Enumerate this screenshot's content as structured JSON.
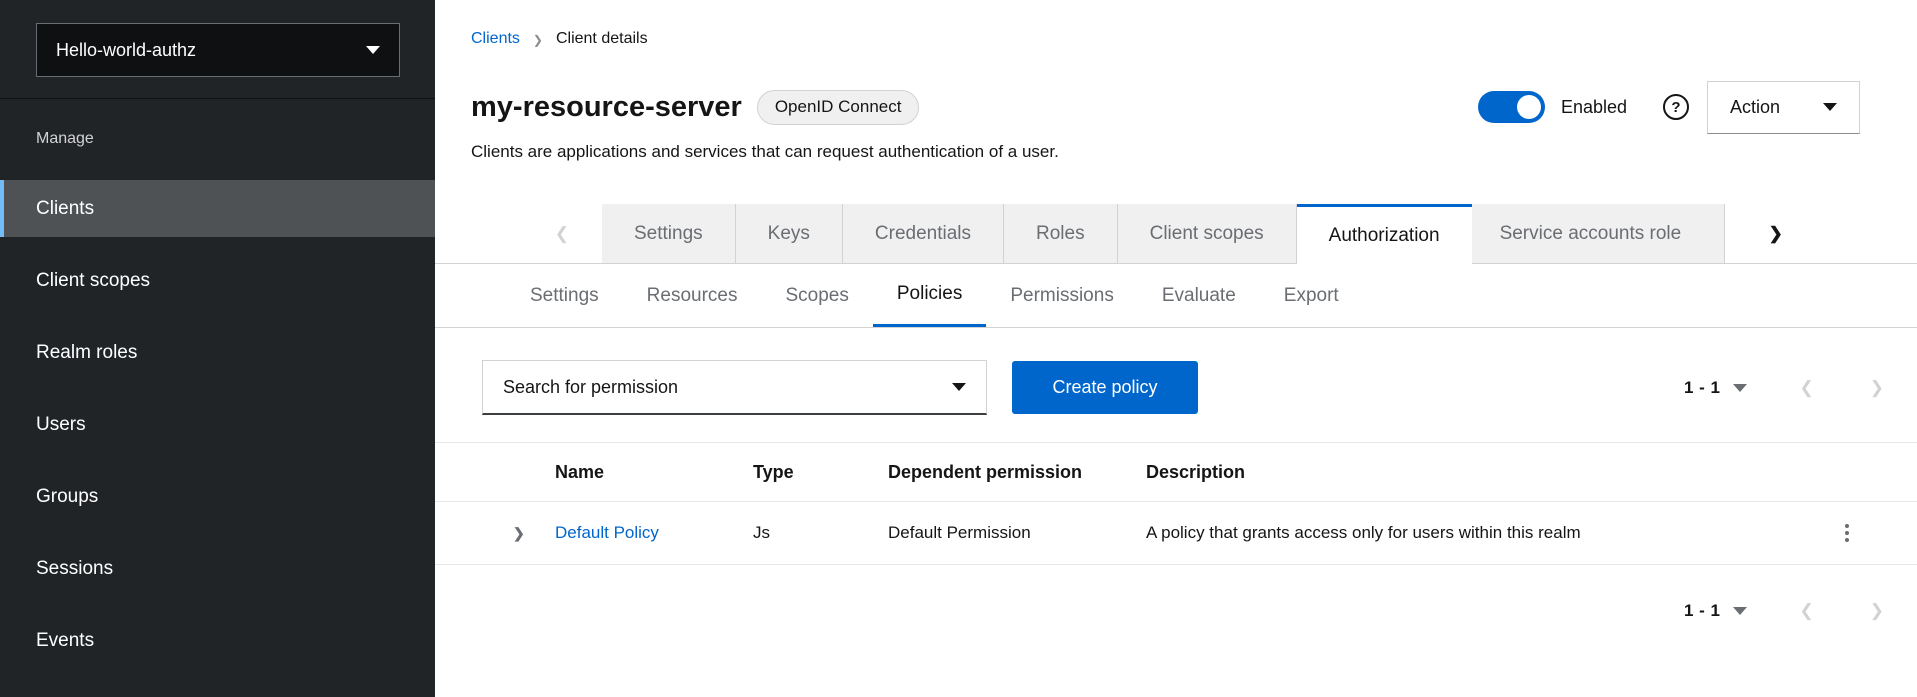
{
  "sidebar": {
    "realm_label": "Hello-world-authz",
    "section_label": "Manage",
    "items": [
      {
        "label": "Clients",
        "active": true
      },
      {
        "label": "Client scopes"
      },
      {
        "label": "Realm roles"
      },
      {
        "label": "Users"
      },
      {
        "label": "Groups"
      },
      {
        "label": "Sessions"
      },
      {
        "label": "Events"
      }
    ]
  },
  "breadcrumb": {
    "items": [
      "Clients",
      "Client details"
    ]
  },
  "header": {
    "title": "my-resource-server",
    "badge": "OpenID Connect",
    "subtitle": "Clients are applications and services that can request authentication of a user.",
    "enabled_label": "Enabled",
    "action_label": "Action"
  },
  "tabs": {
    "items": [
      "Settings",
      "Keys",
      "Credentials",
      "Roles",
      "Client scopes",
      "Authorization",
      "Service accounts role"
    ],
    "active": "Authorization"
  },
  "subtabs": {
    "items": [
      "Settings",
      "Resources",
      "Scopes",
      "Policies",
      "Permissions",
      "Evaluate",
      "Export"
    ],
    "active": "Policies"
  },
  "toolbar": {
    "search_label": "Search for permission",
    "create_label": "Create policy",
    "pagination_label": "1 - 1"
  },
  "table": {
    "columns": [
      "Name",
      "Type",
      "Dependent permission",
      "Description"
    ],
    "rows": [
      {
        "name": "Default Policy",
        "type": "Js",
        "dependent": "Default Permission",
        "description": "A policy that grants access only for users within this realm"
      }
    ]
  },
  "footer": {
    "pagination_label": "1 - 1"
  },
  "colors": {
    "primary": "#0066cc",
    "link": "#0066cc",
    "sidebar_bg": "#212427",
    "sidebar_active_bg": "#4f5255",
    "sidebar_active_indicator": "#73bcf7",
    "tab_inactive_bg": "#f0f0f0",
    "border": "#d2d2d2"
  }
}
